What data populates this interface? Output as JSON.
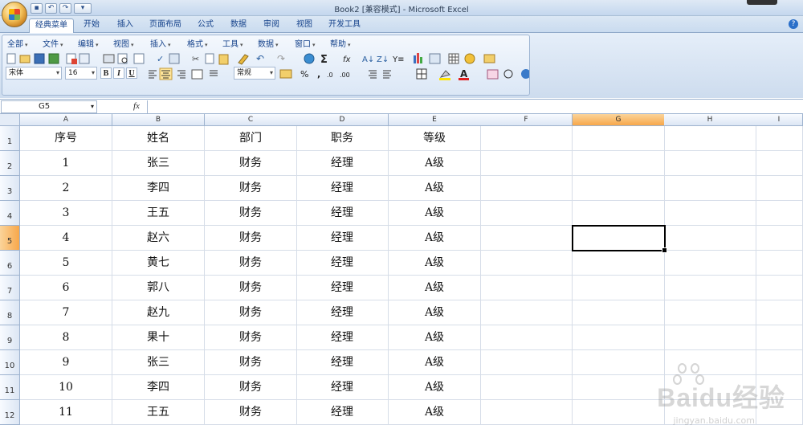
{
  "title": "Book2  [兼容模式] - Microsoft Excel",
  "tabs": [
    "经典菜单",
    "开始",
    "插入",
    "页面布局",
    "公式",
    "数据",
    "审阅",
    "视图",
    "开发工具"
  ],
  "menus": [
    "全部",
    "文件",
    "编辑",
    "视图",
    "插入",
    "格式",
    "工具",
    "数据",
    "窗口",
    "帮助"
  ],
  "font_name": "宋体",
  "font_size": "16",
  "number_format": "常规",
  "name_box": "G5",
  "fx_label": "fx",
  "columns": [
    "A",
    "B",
    "C",
    "D",
    "E",
    "F",
    "G",
    "H",
    "I"
  ],
  "rows": [
    "1",
    "2",
    "3",
    "4",
    "5",
    "6",
    "7",
    "8",
    "9",
    "10",
    "11",
    "12"
  ],
  "selected_cell": "G5",
  "headers": [
    "序号",
    "姓名",
    "部门",
    "职务",
    "等级"
  ],
  "data": [
    [
      "1",
      "张三",
      "财务",
      "经理",
      "A级"
    ],
    [
      "2",
      "李四",
      "财务",
      "经理",
      "A级"
    ],
    [
      "3",
      "王五",
      "财务",
      "经理",
      "A级"
    ],
    [
      "4",
      "赵六",
      "财务",
      "经理",
      "A级"
    ],
    [
      "5",
      "黄七",
      "财务",
      "经理",
      "A级"
    ],
    [
      "6",
      "郭八",
      "财务",
      "经理",
      "A级"
    ],
    [
      "7",
      "赵九",
      "财务",
      "经理",
      "A级"
    ],
    [
      "8",
      "果十",
      "财务",
      "经理",
      "A级"
    ],
    [
      "9",
      "张三",
      "财务",
      "经理",
      "A级"
    ],
    [
      "10",
      "李四",
      "财务",
      "经理",
      "A级"
    ],
    [
      "11",
      "王五",
      "财务",
      "经理",
      "A级"
    ]
  ],
  "watermark": "Baidu经验",
  "watermark_url": "jingyan.baidu.com"
}
